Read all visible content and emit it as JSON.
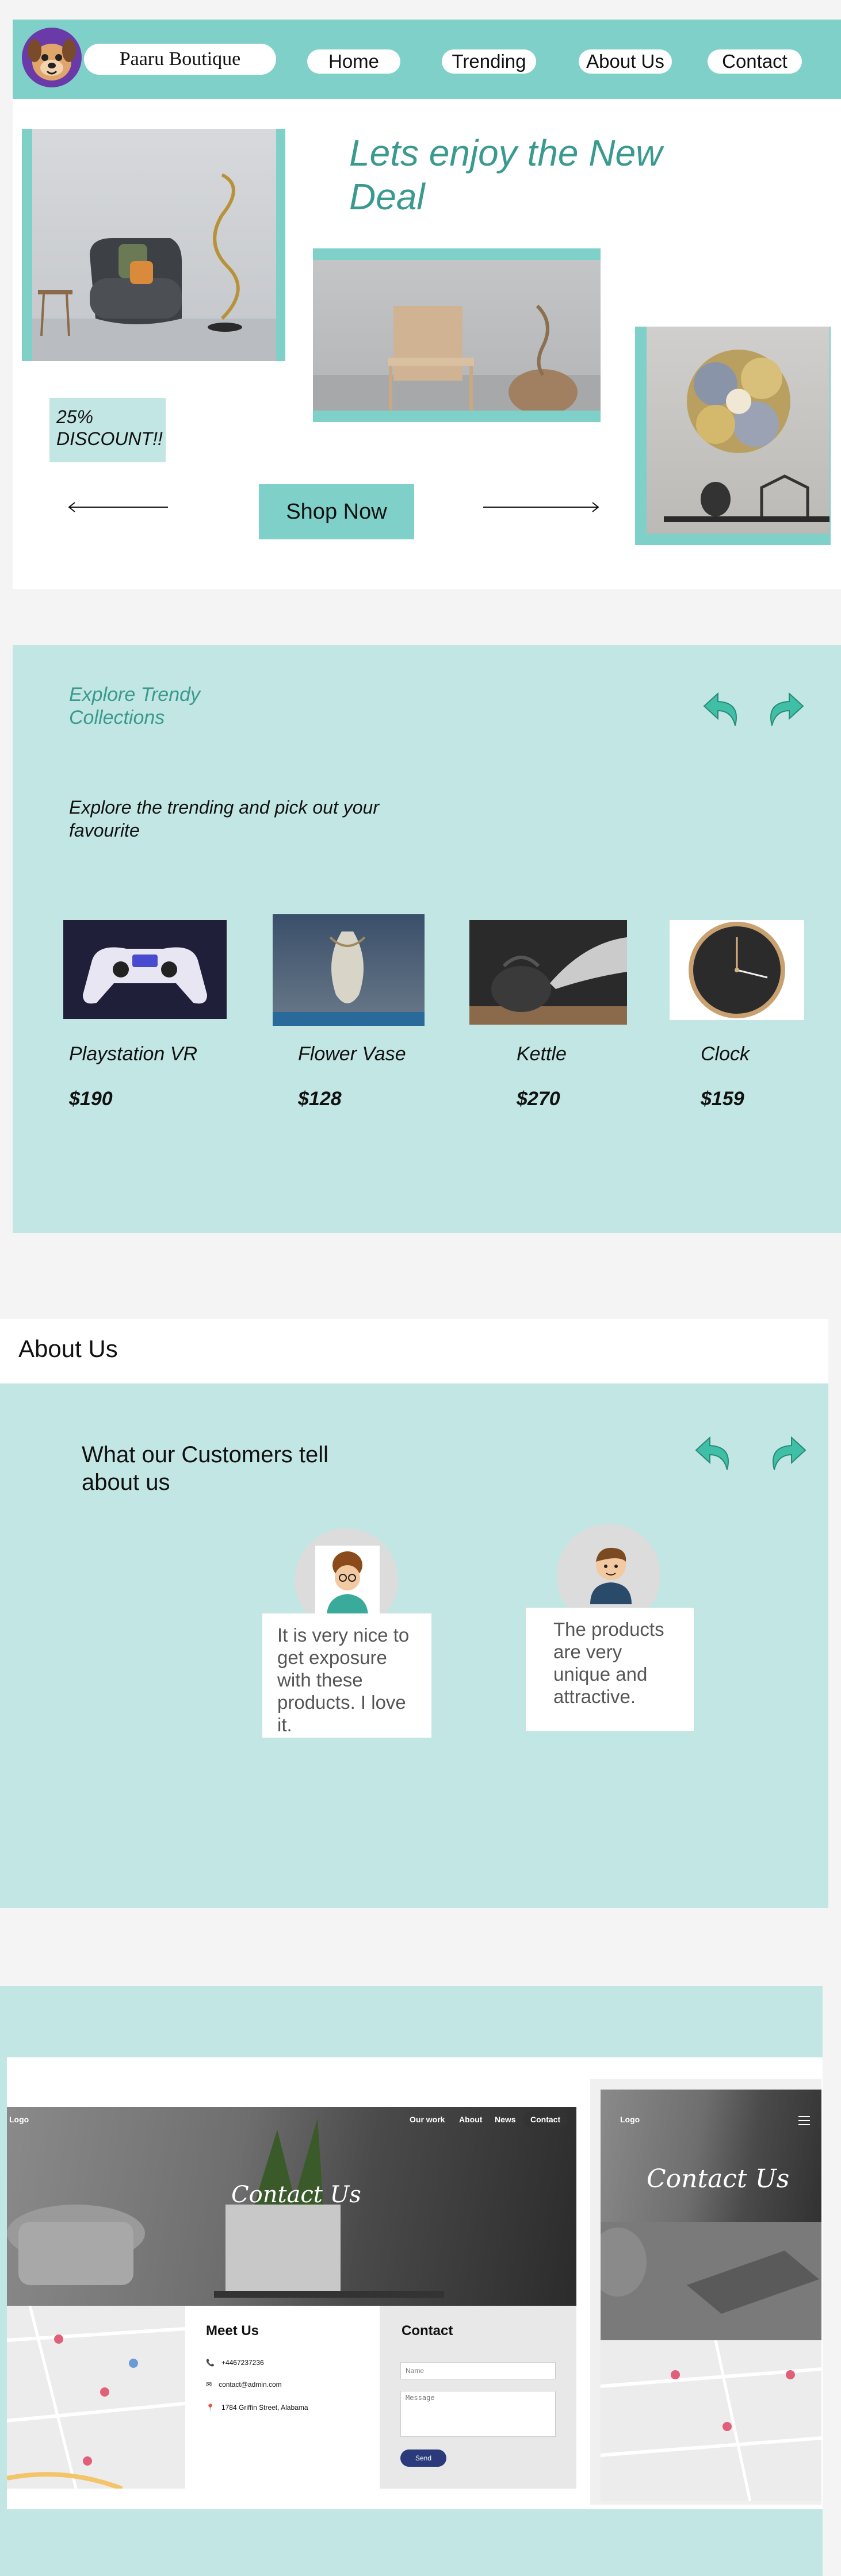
{
  "brand": {
    "name": "Paaru Boutique"
  },
  "nav": {
    "items": [
      "Home",
      "Trending",
      "About Us",
      "Contact"
    ]
  },
  "hero": {
    "title": "Lets enjoy the New Deal",
    "discount": "25% DISCOUNT!!",
    "cta": "Shop Now"
  },
  "trending": {
    "title": "Explore Trendy Collections",
    "subtitle": "Explore the trending and pick out your favourite",
    "products": [
      {
        "name": "Playstation VR",
        "price": "$190"
      },
      {
        "name": "Flower Vase",
        "price": "$128"
      },
      {
        "name": "Kettle",
        "price": "$270"
      },
      {
        "name": "Clock",
        "price": "$159"
      }
    ]
  },
  "about": {
    "title": "About Us",
    "testimonial_title": "What our Customers tell about us",
    "testimonials": [
      {
        "text": "It is very nice to get exposure with these products. I love it."
      },
      {
        "text": "The products are very unique and attractive."
      }
    ]
  },
  "contact": {
    "logo": "Logo",
    "nav": [
      "Our work",
      "About",
      "News",
      "Contact"
    ],
    "hero_title": "Contact Us",
    "meet_us": {
      "title": "Meet Us",
      "phone": "+4467237236",
      "email": "contact@admin.com",
      "address": "1784 Griffin Street, Alabama"
    },
    "form": {
      "title": "Contact",
      "name_placeholder": "Name",
      "message_placeholder": "Message",
      "send": "Send"
    }
  },
  "colors": {
    "accent": "#7fd0c8",
    "accent_light": "#c2e6e3",
    "title_teal": "#3a9a90"
  }
}
